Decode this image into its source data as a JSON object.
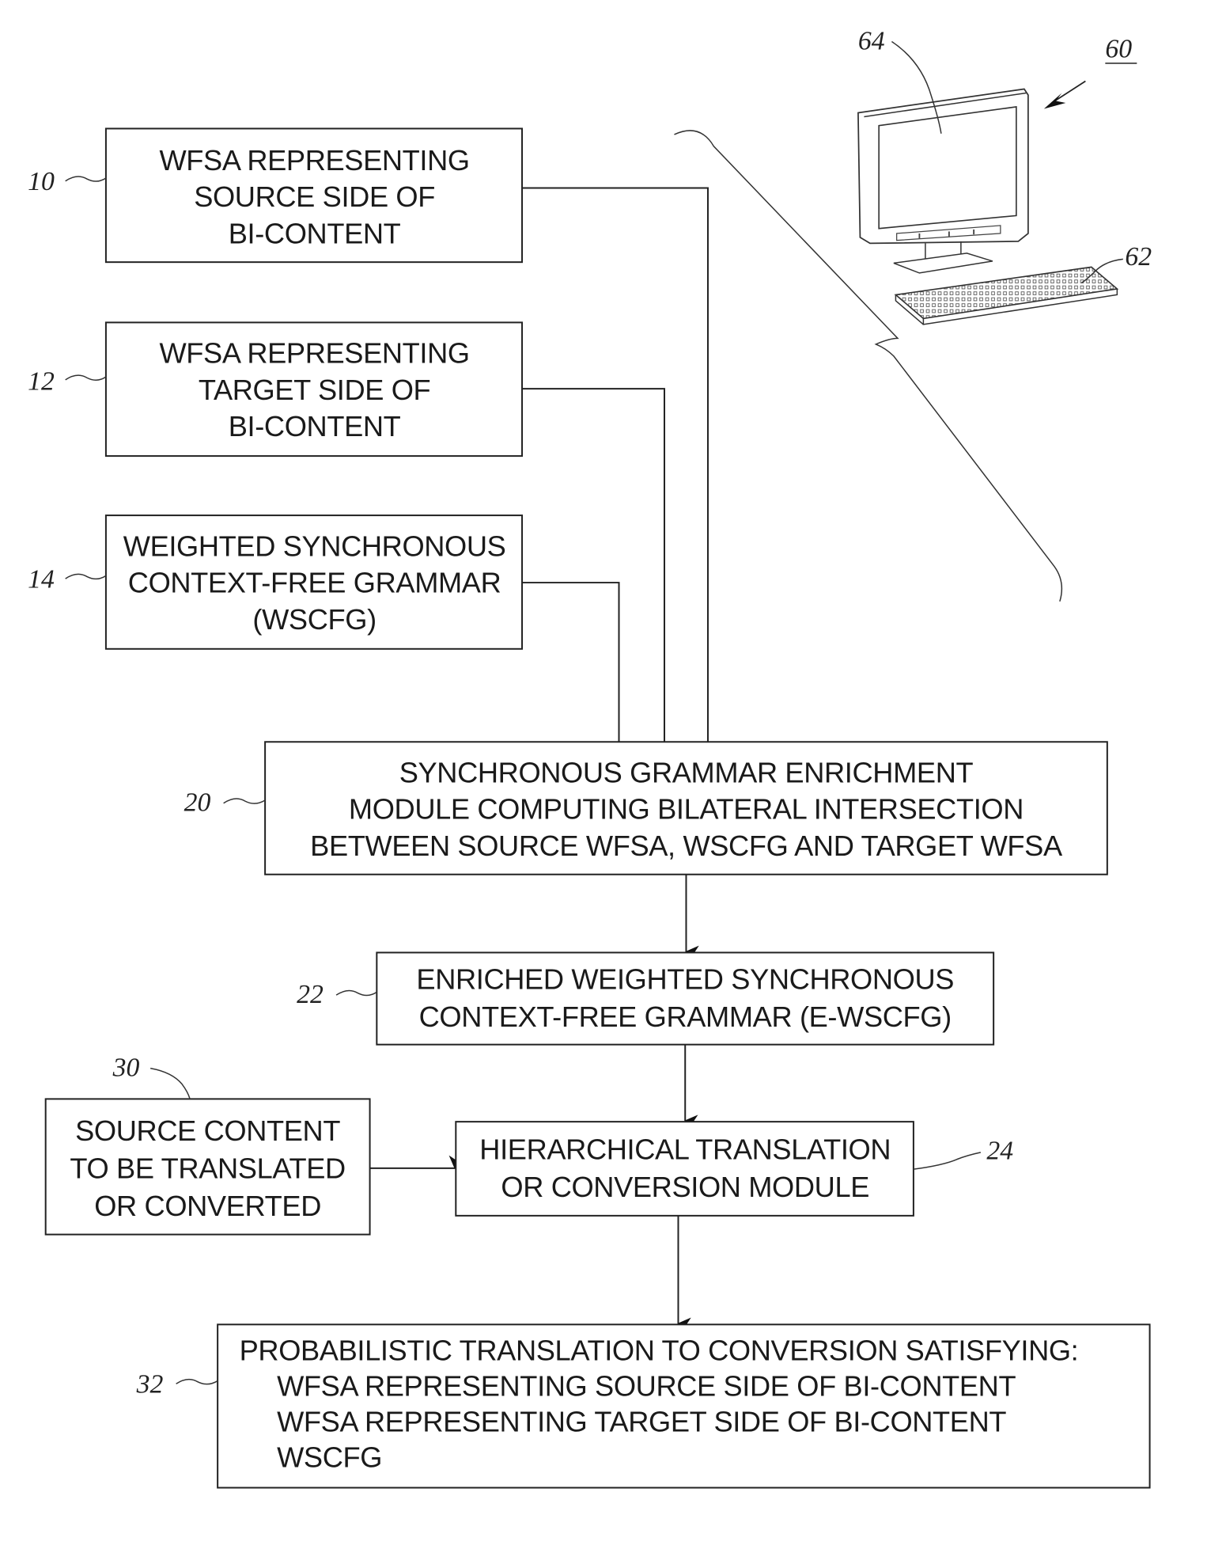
{
  "figure": {
    "boxes": [
      {
        "ref": "10",
        "lines": [
          "WFSA REPRESENTING",
          "SOURCE SIDE OF",
          "BI-CONTENT"
        ]
      },
      {
        "ref": "12",
        "lines": [
          "WFSA REPRESENTING",
          "TARGET SIDE OF",
          "BI-CONTENT"
        ]
      },
      {
        "ref": "14",
        "lines": [
          "WEIGHTED SYNCHRONOUS",
          "CONTEXT-FREE GRAMMAR",
          "(WSCFG)"
        ]
      },
      {
        "ref": "20",
        "lines": [
          "SYNCHRONOUS GRAMMAR ENRICHMENT",
          "MODULE COMPUTING BILATERAL INTERSECTION",
          "BETWEEN SOURCE WFSA, WSCFG AND TARGET WFSA"
        ]
      },
      {
        "ref": "22",
        "lines": [
          "ENRICHED WEIGHTED SYNCHRONOUS",
          "CONTEXT-FREE GRAMMAR (E-WSCFG)"
        ]
      },
      {
        "ref": "30",
        "lines": [
          "SOURCE CONTENT",
          "TO BE TRANSLATED",
          "OR CONVERTED"
        ]
      },
      {
        "ref": "24",
        "lines": [
          "HIERARCHICAL TRANSLATION",
          "OR CONVERSION MODULE"
        ]
      },
      {
        "ref": "32",
        "lines": [
          "PROBABILISTIC TRANSLATION TO CONVERSION SATISFYING:",
          "WFSA REPRESENTING SOURCE SIDE OF BI-CONTENT",
          "WFSA REPRESENTING TARGET SIDE OF BI-CONTENT",
          "WSCFG"
        ]
      }
    ],
    "computer": {
      "system_ref": "60",
      "monitor_ref": "64",
      "keyboard_ref": "62"
    }
  }
}
